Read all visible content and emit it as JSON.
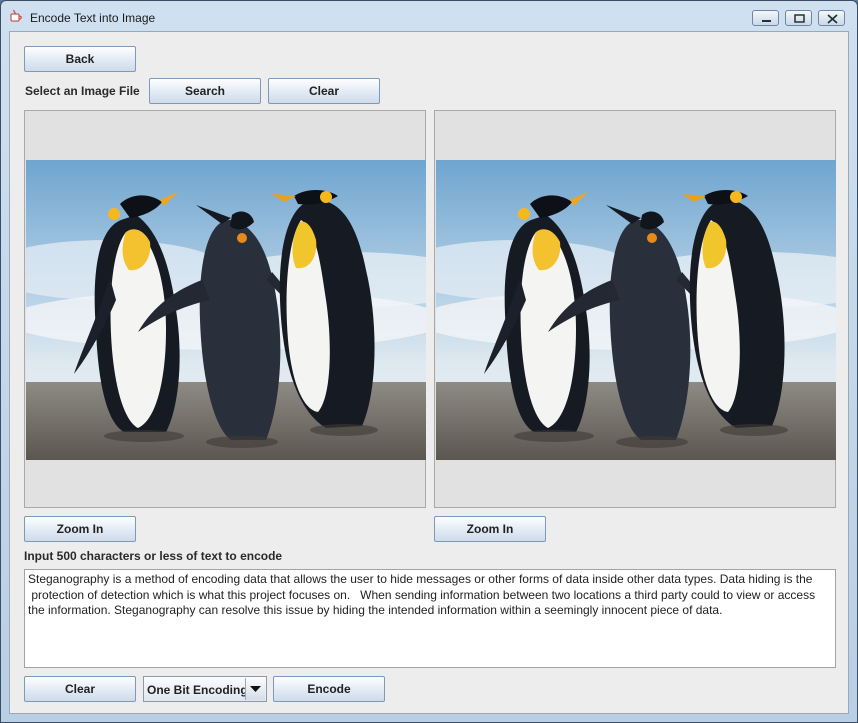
{
  "window": {
    "title": "Encode Text into Image"
  },
  "top": {
    "back_label": "Back",
    "select_label": "Select an Image File",
    "search_label": "Search",
    "clear_label": "Clear"
  },
  "panels": {
    "left": {
      "image": "penguins-photo",
      "zoom_label": "Zoom In"
    },
    "right": {
      "image": "penguins-photo",
      "zoom_label": "Zoom In"
    }
  },
  "input": {
    "instruction": "Input 500 characters or less of text to encode",
    "text": "Steganography is a method of encoding data that allows the user to hide messages or other forms of data inside other data types. Data hiding is the\n protection of detection which is what this project focuses on.   When sending information between two locations a third party could to view or access\nthe information. Steganography can resolve this issue by hiding the intended information within a seemingly innocent piece of data."
  },
  "bottom": {
    "clear_label": "Clear",
    "encoding_selected": "One Bit Encoding",
    "encode_label": "Encode"
  },
  "icons": {
    "app": "java-cup-icon",
    "minimize": "minimize-icon",
    "maximize": "maximize-icon",
    "close": "close-icon",
    "dropdown": "chevron-down-icon"
  }
}
